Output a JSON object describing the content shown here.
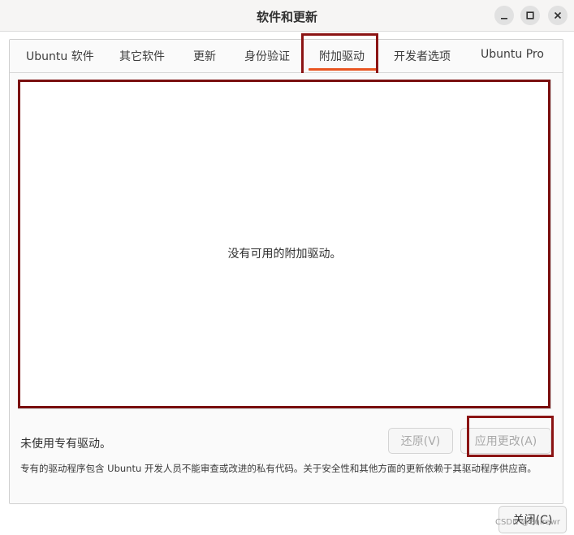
{
  "window": {
    "title": "软件和更新"
  },
  "tabs": [
    {
      "label": "Ubuntu 软件"
    },
    {
      "label": "其它软件"
    },
    {
      "label": "更新"
    },
    {
      "label": "身份验证"
    },
    {
      "label": "附加驱动",
      "selected": true
    },
    {
      "label": "开发者选项"
    },
    {
      "label": "Ubuntu Pro"
    }
  ],
  "drivers": {
    "empty_message": "没有可用的附加驱动。",
    "status_text": "未使用专有驱动。",
    "note": "专有的驱动程序包含 Ubuntu 开发人员不能审查或改进的私有代码。关于安全性和其他方面的更新依赖于其驱动程序供应商。"
  },
  "buttons": {
    "revert": "还原(V)",
    "apply": "应用更改(A)",
    "close": "关闭(C)"
  },
  "watermark": "CSDN @Bulrewr",
  "colors": {
    "accent": "#e95420",
    "highlight_box": "#8b1414"
  }
}
